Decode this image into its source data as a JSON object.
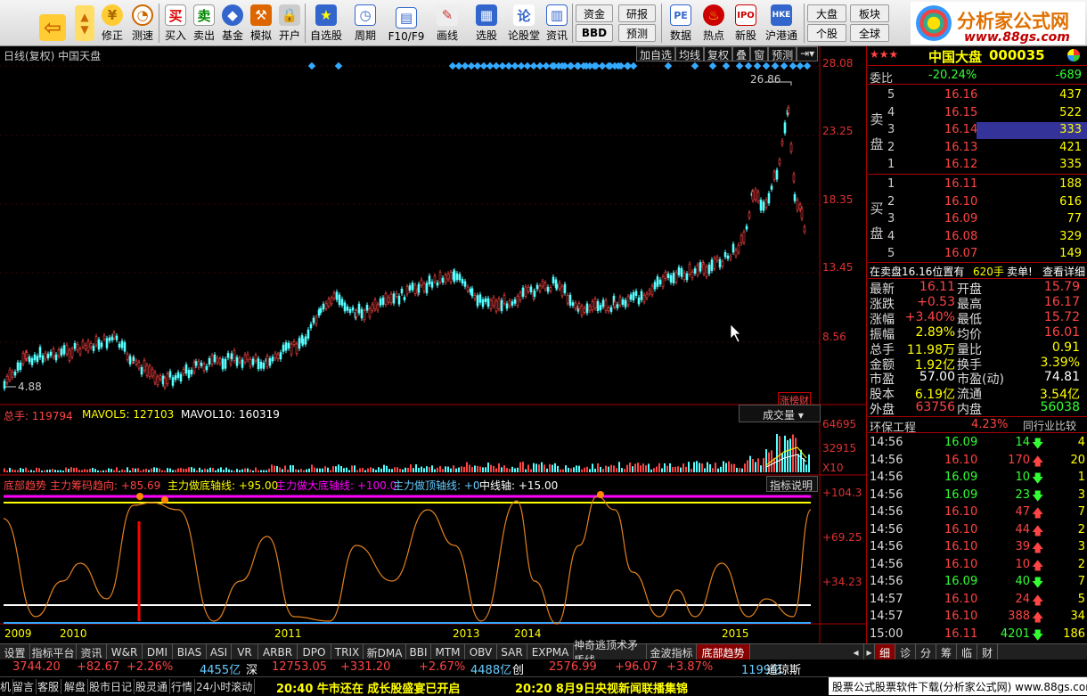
{
  "toolbar": {
    "buttons": [
      {
        "label": "",
        "icon": "back-arrow-icon"
      },
      {
        "label": "",
        "icon": "up-down-arrow-icon"
      },
      {
        "label": "修正",
        "icon": "coin-icon"
      },
      {
        "label": "测速",
        "icon": "clock-icon"
      },
      {
        "label": "买入",
        "icon": "buy-icon",
        "glyph": "买"
      },
      {
        "label": "卖出",
        "icon": "sell-icon",
        "glyph": "卖"
      },
      {
        "label": "基金",
        "icon": "fund-icon"
      },
      {
        "label": "模拟",
        "icon": "hammer-icon"
      },
      {
        "label": "开户",
        "icon": "lock-icon"
      },
      {
        "label": "自选股",
        "icon": "star-icon"
      },
      {
        "label": "周期",
        "icon": "clock-icon"
      },
      {
        "label": "F10/F9",
        "icon": "f10-icon"
      },
      {
        "label": "画线",
        "icon": "pen-icon"
      },
      {
        "label": "选股",
        "icon": "screen-icon"
      },
      {
        "label": "论股堂",
        "icon": "forum-icon",
        "glyph": "论"
      },
      {
        "label": "资讯",
        "icon": "news-icon"
      },
      {
        "label": "数据",
        "icon": "pe-icon",
        "glyph": "PE"
      },
      {
        "label": "热点",
        "icon": "fire-icon"
      },
      {
        "label": "新股",
        "icon": "new-stock-icon"
      },
      {
        "label": "沪港通",
        "icon": "hkex-icon"
      }
    ],
    "small": [
      "资金",
      "BBD",
      "研报",
      "预测",
      "大盘",
      "个股",
      "板块",
      "全球"
    ]
  },
  "logo": {
    "text": "分析家公式网",
    "url": "www.88gs.com"
  },
  "chart": {
    "title": "日线(复权)  中国天盘",
    "buttons": [
      "加自选",
      "均线",
      "复权",
      "叠",
      "窗",
      "预测"
    ],
    "price_labels": [
      "28.08",
      "23.25",
      "18.35",
      "13.45",
      "8.56"
    ],
    "max_label": "26.86",
    "min_label": "4.88",
    "badge": "涨榜财",
    "volume": {
      "total_label": "总手: 119794",
      "mavol5": "MAVOL5: 127103",
      "mavol10": "MAVOL10: 160319",
      "dropdown": "成交量",
      "labels": [
        "64695",
        "32915",
        "X10"
      ]
    },
    "indicator": {
      "name": "底部趋势",
      "items": [
        "主力筹码趋向: +85.69",
        "主力做底轴线: +95.00",
        "主力做大底轴线: +100.0",
        "主力做顶轴线: +0",
        "中线轴: +15.00"
      ],
      "button": "指标说明",
      "labels": [
        "+104.3",
        "+69.25",
        "+34.23"
      ]
    },
    "years": [
      "2009",
      "2010",
      "2011",
      "2013",
      "2014",
      "2015"
    ]
  },
  "quote": {
    "name": "中国大盘",
    "code": "000035",
    "weibi": {
      "label": "委比",
      "pct": "-20.24%",
      "val": "-689"
    },
    "sell": [
      {
        "n": "5",
        "p": "16.16",
        "v": "437"
      },
      {
        "n": "4",
        "p": "16.15",
        "v": "522"
      },
      {
        "n": "3",
        "p": "16.14",
        "v": "333"
      },
      {
        "n": "2",
        "p": "16.13",
        "v": "421"
      },
      {
        "n": "1",
        "p": "16.12",
        "v": "335"
      }
    ],
    "buy": [
      {
        "n": "1",
        "p": "16.11",
        "v": "188"
      },
      {
        "n": "2",
        "p": "16.10",
        "v": "616"
      },
      {
        "n": "3",
        "p": "16.09",
        "v": "77"
      },
      {
        "n": "4",
        "p": "16.08",
        "v": "329"
      },
      {
        "n": "5",
        "p": "16.07",
        "v": "149"
      }
    ],
    "sell_label": [
      "卖",
      "盘"
    ],
    "buy_label": [
      "买",
      "盘"
    ],
    "notice": "在卖盘16.16位置有",
    "notice_vol": "620手",
    "notice_act": "卖单!",
    "notice_link": "查看详细",
    "stats": [
      [
        "最新",
        "16.11",
        "开盘",
        "15.79"
      ],
      [
        "涨跌",
        "+0.53",
        "最高",
        "16.17"
      ],
      [
        "涨幅",
        "+3.40%",
        "最低",
        "15.72"
      ],
      [
        "振幅",
        "2.89%",
        "均价",
        "16.01"
      ],
      [
        "总手",
        "11.98万",
        "量比",
        "0.91"
      ],
      [
        "金额",
        "1.92亿",
        "换手",
        "3.39%"
      ],
      [
        "市盈",
        "57.00",
        "市盈(动)",
        "74.81"
      ],
      [
        "股本",
        "6.19亿",
        "流通",
        "3.54亿"
      ],
      [
        "外盘",
        "63756",
        "内盘",
        "56038"
      ]
    ],
    "industry": "环保工程",
    "industry_pct": "4.23%",
    "industry_btn": "同行业比较",
    "trades": [
      [
        "14:56",
        "16.09",
        "14",
        "4",
        "down"
      ],
      [
        "14:56",
        "16.10",
        "170",
        "20",
        "up"
      ],
      [
        "14:56",
        "16.09",
        "10",
        "1",
        "down"
      ],
      [
        "14:56",
        "16.09",
        "23",
        "3",
        "down"
      ],
      [
        "14:56",
        "16.10",
        "47",
        "7",
        "up"
      ],
      [
        "14:56",
        "16.10",
        "44",
        "2",
        "up"
      ],
      [
        "14:56",
        "16.10",
        "39",
        "3",
        "up"
      ],
      [
        "14:56",
        "16.10",
        "10",
        "2",
        "up"
      ],
      [
        "14:56",
        "16.09",
        "40",
        "7",
        "down"
      ],
      [
        "14:57",
        "16.10",
        "24",
        "5",
        "up"
      ],
      [
        "14:57",
        "16.10",
        "388",
        "34",
        "up"
      ],
      [
        "15:00",
        "16.11",
        "4201",
        "186",
        "down"
      ]
    ]
  },
  "tabs": [
    "设置",
    "指标平台",
    "资讯",
    "W&R",
    "DMI",
    "BIAS",
    "ASI",
    "VR",
    "ARBR",
    "DPO",
    "TRIX",
    "新DMA",
    "BBI",
    "MTM",
    "OBV",
    "SAR",
    "EXPMA",
    "神奇逃顶术矛盾线",
    "金波指标",
    "底部趋势"
  ],
  "tabs_right": [
    "细",
    "诊",
    "分",
    "筹",
    "临",
    "财"
  ],
  "ticker": [
    {
      "idx": "3744.20",
      "chg": "+82.67",
      "pct": "+2.26%",
      "amt": "4455亿",
      "mk": "深"
    },
    {
      "idx": "12753.05",
      "chg": "+331.20",
      "pct": "+2.67%",
      "amt": "4488亿",
      "mk": "创"
    },
    {
      "idx": "2576.99",
      "chg": "+96.07",
      "pct": "+3.87%",
      "amt": "1199亿",
      "mk": "道琼斯"
    }
  ],
  "statusbar": {
    "items": [
      "机",
      "留言",
      "客服",
      "解盘",
      "股市日记",
      "股灵通",
      "行情",
      "24小时滚动"
    ],
    "news1": "20:40 牛市还在 成长股盛宴已开启",
    "news2": "20:20 8月9日央视新闻联播集锦",
    "right": "股票公式股票软件下载(分析家公式网) www.88gs.com"
  }
}
